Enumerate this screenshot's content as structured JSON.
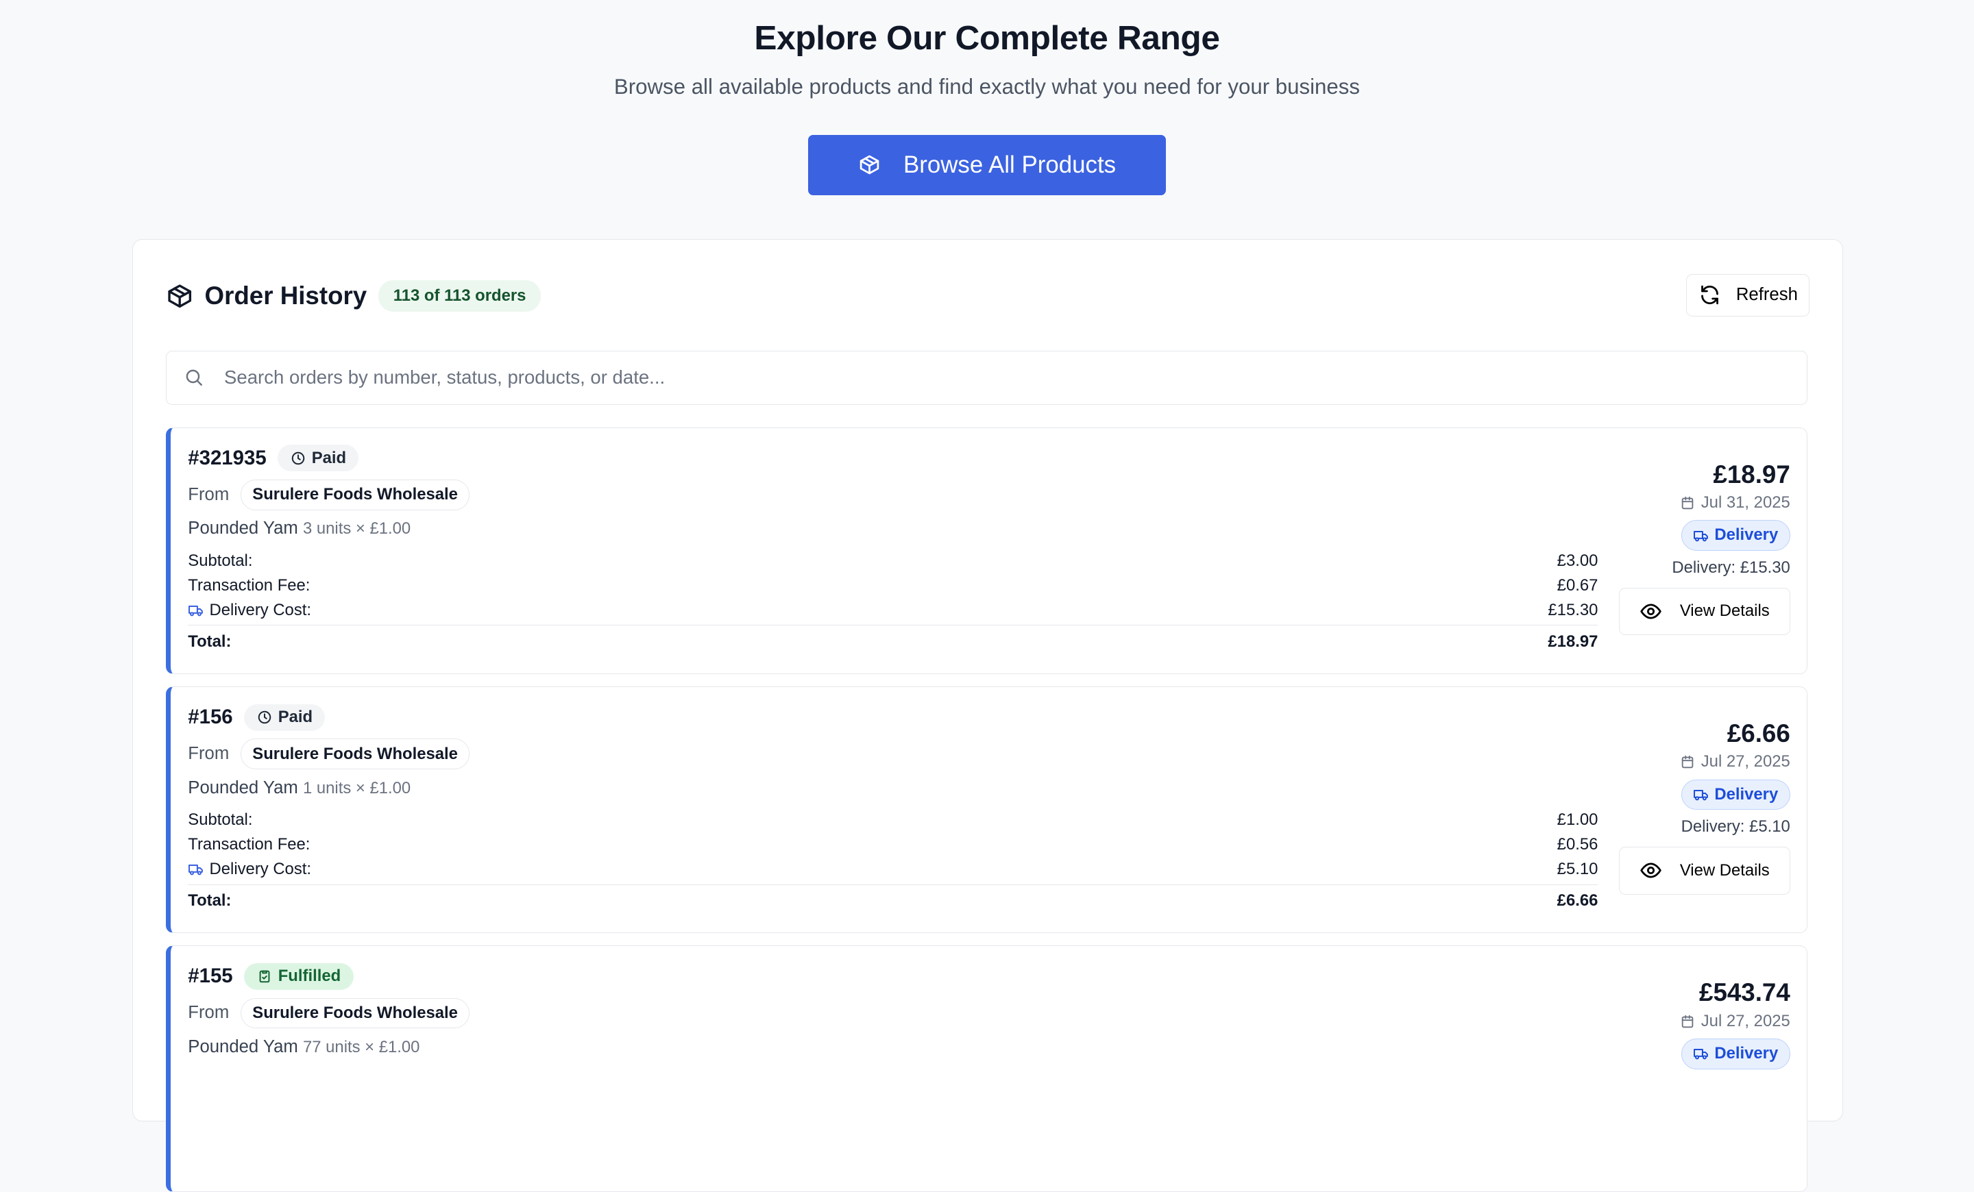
{
  "hero": {
    "title": "Explore Our Complete Range",
    "subtitle": "Browse all available products and find exactly what you need for your business",
    "button_label": "Browse All Products"
  },
  "panel": {
    "title": "Order History",
    "count_badge": "113 of 113 orders",
    "refresh_label": "Refresh",
    "search_placeholder": "Search orders by number, status, products, or date..."
  },
  "labels": {
    "from": "From",
    "subtotal": "Subtotal:",
    "fee": "Transaction Fee:",
    "delivery_cost": "Delivery Cost:",
    "total": "Total:",
    "view_details": "View Details"
  },
  "orders": [
    {
      "number": "#321935",
      "status": "Paid",
      "vendor": "Surulere Foods Wholesale",
      "product": "Pounded Yam",
      "qty": "3 units × £1.00",
      "subtotal": "£3.00",
      "fee": "£0.67",
      "delivery_cost": "£15.30",
      "total": "£18.97",
      "amount": "£18.97",
      "date": "Jul 31, 2025",
      "method": "Delivery",
      "delivery_note": "Delivery: £15.30"
    },
    {
      "number": "#156",
      "status": "Paid",
      "vendor": "Surulere Foods Wholesale",
      "product": "Pounded Yam",
      "qty": "1 units × £1.00",
      "subtotal": "£1.00",
      "fee": "£0.56",
      "delivery_cost": "£5.10",
      "total": "£6.66",
      "amount": "£6.66",
      "date": "Jul 27, 2025",
      "method": "Delivery",
      "delivery_note": "Delivery: £5.10"
    },
    {
      "number": "#155",
      "status": "Fulfilled",
      "vendor": "Surulere Foods Wholesale",
      "product": "Pounded Yam",
      "qty": "77 units × £1.00",
      "amount": "£543.74",
      "date": "Jul 27, 2025",
      "method": "Delivery"
    }
  ],
  "colors": {
    "primary": "#3b62e0",
    "accent_border": "#3b6ee0",
    "fulfilled_bg": "#dcf5e3",
    "badge_bg": "#ecf7ef"
  },
  "icons": {
    "browse": "package-icon",
    "title": "package-icon",
    "refresh": "refresh-icon",
    "search": "search-icon",
    "paid": "clock-icon",
    "fulfilled": "clipboard-check-icon",
    "delivery": "truck-icon",
    "date": "calendar-icon",
    "view": "eye-icon"
  }
}
